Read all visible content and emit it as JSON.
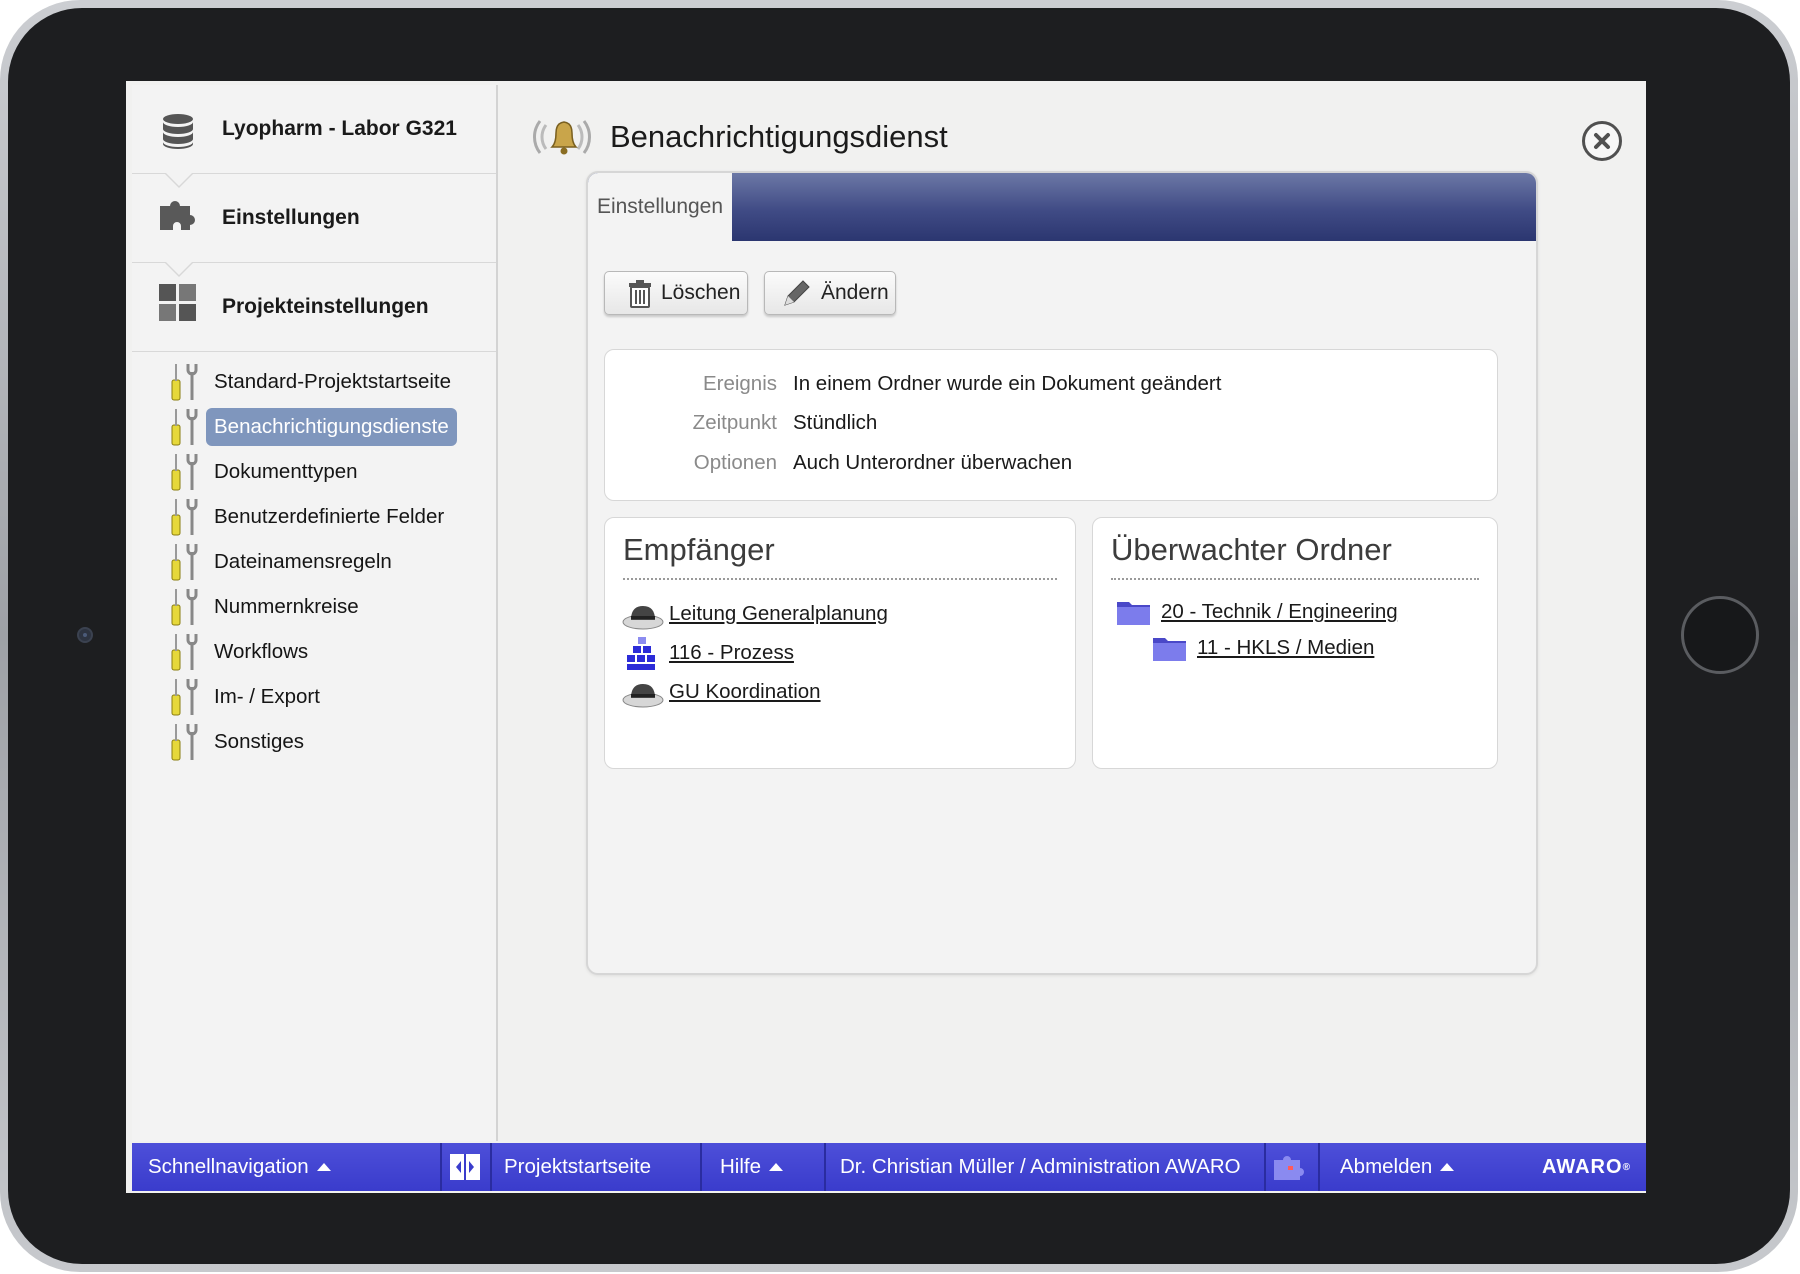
{
  "sidebar": {
    "project_name": "Lyopharm - Labor G321",
    "section_settings": "Einstellungen",
    "section_project_settings": "Projekteinstellungen",
    "items": [
      {
        "label": "Standard-Projektstartseite",
        "active": false
      },
      {
        "label": "Benachrichtigungsdienste",
        "active": true
      },
      {
        "label": "Dokumenttypen",
        "active": false
      },
      {
        "label": "Benutzerdefinierte Felder",
        "active": false
      },
      {
        "label": "Dateinamensregeln",
        "active": false
      },
      {
        "label": "Nummernkreise",
        "active": false
      },
      {
        "label": "Workflows",
        "active": false
      },
      {
        "label": "Im- / Export",
        "active": false
      },
      {
        "label": "Sonstiges",
        "active": false
      }
    ]
  },
  "main": {
    "title": "Benachrichtigungsdienst",
    "tab_label": "Einstellungen",
    "buttons": {
      "delete": "Löschen",
      "edit": "Ändern"
    },
    "info": [
      {
        "key": "Ereignis",
        "value": "In einem Ordner wurde ein Dokument geändert"
      },
      {
        "key": "Zeitpunkt",
        "value": "Stündlich"
      },
      {
        "key": "Optionen",
        "value": "Auch Unterordner überwachen"
      }
    ],
    "recipients": {
      "title": "Empfänger",
      "items": [
        {
          "label": "Leitung Generalplanung",
          "icon": "hat-icon"
        },
        {
          "label": "116 - Prozess",
          "icon": "group-blocks-icon"
        },
        {
          "label": "GU Koordination",
          "icon": "hat-icon"
        }
      ]
    },
    "watched_folder": {
      "title": "Überwachter Ordner",
      "items": [
        {
          "label": "20 - Technik / Engineering",
          "level": 0
        },
        {
          "label": "11 - HKLS / Medien",
          "level": 1
        }
      ]
    }
  },
  "bottombar": {
    "quicknav": "Schnellnavigation",
    "project_home": "Projektstartseite",
    "help": "Hilfe",
    "user": "Dr. Christian Müller / Administration AWARO",
    "logout": "Abmelden",
    "brand": "AWARO"
  },
  "colors": {
    "bottombar": "#3f41d0",
    "active_item": "#7f96bd",
    "tab_header": "#404b85"
  }
}
